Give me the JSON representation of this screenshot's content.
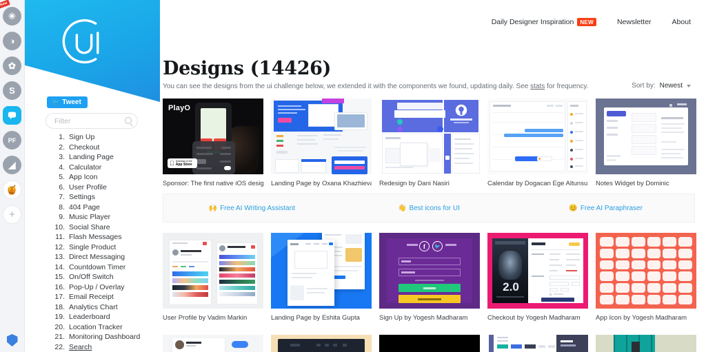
{
  "rail": {
    "items": [
      {
        "name": "snowflake-extension-icon",
        "glyph": "✳",
        "badge": "New"
      },
      {
        "name": "cup-extension-icon",
        "glyph": "◑",
        "badge": ""
      },
      {
        "name": "palette-extension-icon",
        "glyph": "✿",
        "badge": ""
      },
      {
        "name": "s-extension-icon",
        "glyph": "S",
        "badge": ""
      },
      {
        "name": "chat-bubble-extension-icon",
        "glyph": "▢",
        "badge": ""
      },
      {
        "name": "pf-extension-icon",
        "glyph": "PF",
        "badge": ""
      },
      {
        "name": "chart-extension-icon",
        "glyph": "◢",
        "badge": ""
      },
      {
        "name": "honey-extension-icon",
        "glyph": "🍯",
        "badge": ""
      },
      {
        "name": "add-extension-icon",
        "glyph": "+",
        "badge": ""
      }
    ]
  },
  "sidebar": {
    "logo_alt": "UI logo",
    "tweet_label": "Tweet",
    "filter_placeholder": "Filter",
    "filter_value": "",
    "challenges": [
      {
        "num": "1.",
        "label": "Sign Up"
      },
      {
        "num": "2.",
        "label": "Checkout"
      },
      {
        "num": "3.",
        "label": "Landing Page"
      },
      {
        "num": "4.",
        "label": "Calculator"
      },
      {
        "num": "5.",
        "label": "App Icon"
      },
      {
        "num": "6.",
        "label": "User Profile"
      },
      {
        "num": "7.",
        "label": "Settings"
      },
      {
        "num": "8.",
        "label": "404 Page"
      },
      {
        "num": "9.",
        "label": "Music Player"
      },
      {
        "num": "10.",
        "label": "Social Share"
      },
      {
        "num": "11.",
        "label": "Flash Messages"
      },
      {
        "num": "12.",
        "label": "Single Product"
      },
      {
        "num": "13.",
        "label": "Direct Messaging"
      },
      {
        "num": "14.",
        "label": "Countdown Timer"
      },
      {
        "num": "15.",
        "label": "On/Off Switch"
      },
      {
        "num": "16.",
        "label": "Pop-Up / Overlay"
      },
      {
        "num": "17.",
        "label": "Email Receipt"
      },
      {
        "num": "18.",
        "label": "Analytics Chart"
      },
      {
        "num": "19.",
        "label": "Leaderboard"
      },
      {
        "num": "20.",
        "label": "Location Tracker"
      },
      {
        "num": "21.",
        "label": "Monitoring Dashboard"
      },
      {
        "num": "22.",
        "label": "Search"
      }
    ]
  },
  "topnav": {
    "daily": "Daily Designer Inspiration",
    "daily_badge": "NEW",
    "newsletter": "Newsletter",
    "about": "About"
  },
  "header": {
    "title": "Designs (14426)",
    "subtitle_pre": "You can see the designs from the ui challenge below, we extended it with the components we found, updating daily. See ",
    "subtitle_link": "stats",
    "subtitle_post": " for frequency.",
    "sort_label": "Sort by:",
    "sort_value": "Newest"
  },
  "promo": {
    "items": [
      {
        "emoji": "🙌",
        "label": "Free AI Writing Assistant"
      },
      {
        "emoji": "👋",
        "label": "Best icons for UI"
      },
      {
        "emoji": "😊",
        "label": "Free AI Paraphraser"
      }
    ]
  },
  "grid": {
    "row1": [
      {
        "caption": "Sponsor: The first native iOS design toc",
        "art": "sponsor",
        "sponsor": {
          "brand": "PlayO",
          "store_top": "Download on the",
          "store_bottom": "App Store"
        }
      },
      {
        "caption": "Landing Page by Oxana Khazhieva",
        "art": "landing2"
      },
      {
        "caption": "Redesign by Dani Nasiri",
        "art": "redesign3",
        "github_label": "GitHub"
      },
      {
        "caption": "Calendar by Dogacan Ege Altunsu",
        "art": "calendar4"
      },
      {
        "caption": "Notes Widget by Dominic",
        "art": "notes5"
      }
    ],
    "row2": [
      {
        "caption": "User Profile by Vadim Markin",
        "art": "profile6"
      },
      {
        "caption": "Landing Page by Eshita Gupta",
        "art": "landing7"
      },
      {
        "caption": "Sign Up by Yogesh Madharam",
        "art": "signup8"
      },
      {
        "caption": "Checkout by Yogesh Madharam",
        "art": "checkout9",
        "poster_title": "2.0"
      },
      {
        "caption": "App Icon by Yogesh Madharam",
        "art": "appicon10"
      }
    ],
    "row3": [
      {
        "caption": "",
        "art": "r3a"
      },
      {
        "caption": "",
        "art": "r3b"
      },
      {
        "caption": "",
        "art": "r3c"
      },
      {
        "caption": "",
        "art": "r3d"
      },
      {
        "caption": "",
        "art": "r3e"
      }
    ]
  },
  "colors": {
    "brand_blue": "#1aa6e8",
    "twitter_blue": "#1da1f2",
    "accent_red": "#fa3e14",
    "link_blue": "#2a9fe0"
  }
}
